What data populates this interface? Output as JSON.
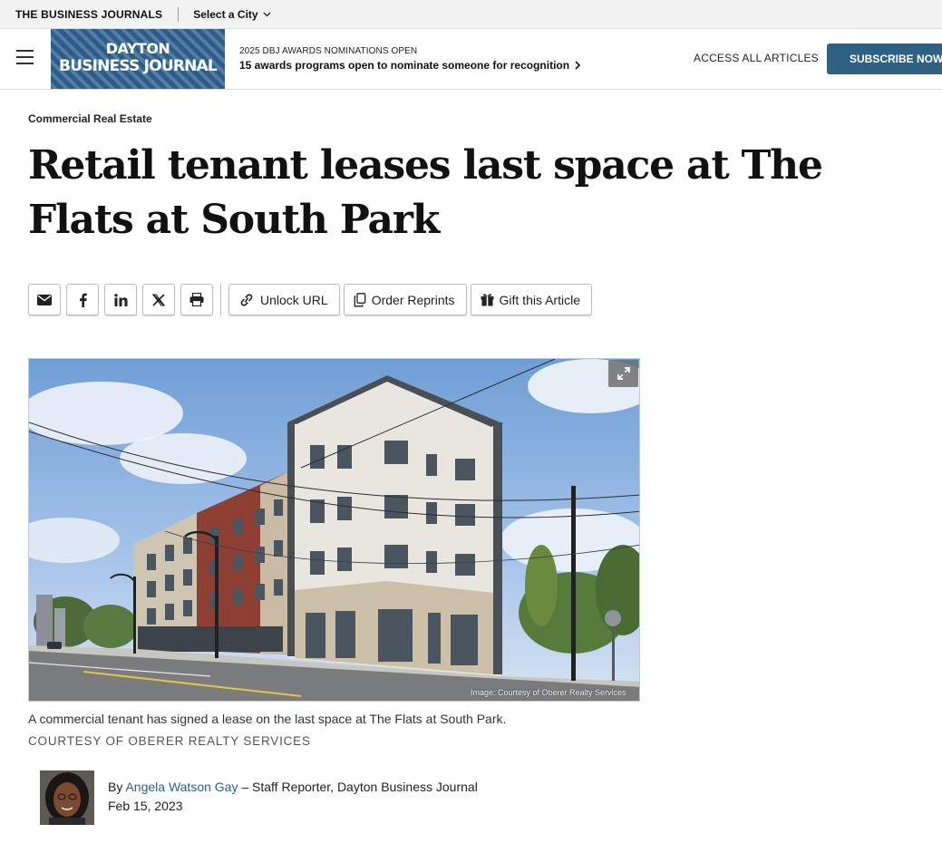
{
  "network_bar": {
    "brand": "THE BUSINESS JOURNALS",
    "city_selector": "Select a City"
  },
  "header": {
    "logo_line1": "DAYTON",
    "logo_line2": "BUSINESS JOURNAL",
    "promo_kicker": "2025 DBJ AWARDS NOMINATIONS OPEN",
    "promo_text": "15 awards programs open to nominate someone for recognition",
    "access_label": "ACCESS ALL ARTICLES",
    "subscribe_label": "SUBSCRIBE NOW"
  },
  "article": {
    "section": "Commercial Real Estate",
    "headline": "Retail tenant leases last space at The Flats at South Park",
    "share_buttons": [
      "email-icon",
      "facebook-icon",
      "linkedin-icon",
      "x-icon",
      "print-icon"
    ],
    "actions": {
      "unlock": "Unlock URL",
      "reprints": "Order Reprints",
      "gift": "Gift this Article"
    },
    "image_credit_overlay": "Image: Courtesy of Oberer Realty Services",
    "caption": "A commercial tenant has signed a lease on the last space at The Flats at South Park.",
    "courtesy": "COURTESY OF OBERER REALTY SERVICES",
    "byline_prefix": "By",
    "author": "Angela Watson Gay",
    "author_role": " – Staff Reporter, Dayton Business Journal",
    "date": "Feb 15, 2023"
  },
  "colors": {
    "brand_blue": "#2f6185",
    "logo_blue": "#2f5b84",
    "link_blue": "#2f6185"
  }
}
